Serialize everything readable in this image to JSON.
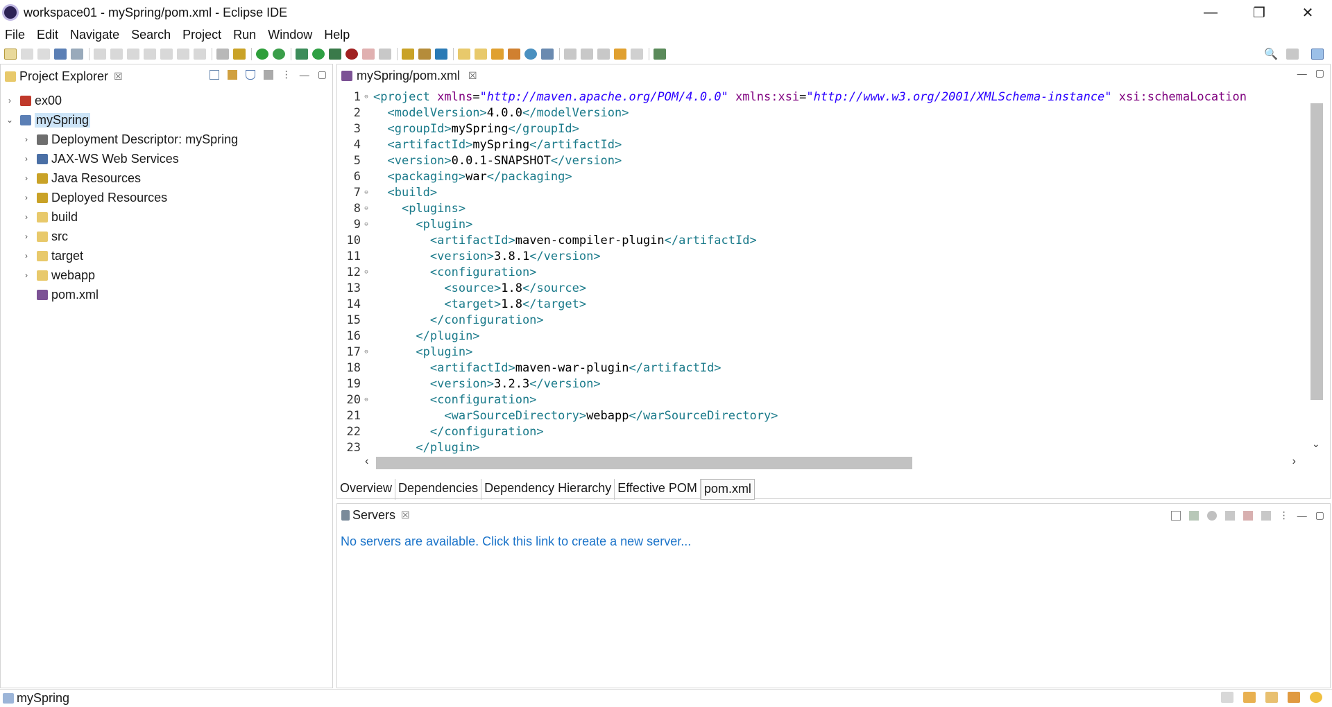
{
  "window": {
    "title": "workspace01 - mySpring/pom.xml - Eclipse IDE",
    "controls": [
      "—",
      "❐",
      "✕"
    ]
  },
  "menu": [
    "File",
    "Edit",
    "Navigate",
    "Search",
    "Project",
    "Run",
    "Window",
    "Help"
  ],
  "explorer": {
    "title": "Project Explorer",
    "close": "☒",
    "items": [
      {
        "label": "ex00",
        "twisty": "›",
        "icon_color": "#c0392b"
      },
      {
        "label": "mySpring",
        "twisty": "⌄",
        "icon_color": "#5b7fb5",
        "selected": true
      },
      {
        "label": "Deployment Descriptor: mySpring",
        "twisty": "›",
        "icon_color": "#6e6e6e"
      },
      {
        "label": "JAX-WS Web Services",
        "twisty": "›",
        "icon_color": "#4a6fa5"
      },
      {
        "label": "Java Resources",
        "twisty": "›",
        "icon_color": "#c9a227"
      },
      {
        "label": "Deployed Resources",
        "twisty": "›",
        "icon_color": "#c9a227"
      },
      {
        "label": "build",
        "twisty": "›",
        "icon_color": "#e8c96b"
      },
      {
        "label": "src",
        "twisty": "›",
        "icon_color": "#e8c96b"
      },
      {
        "label": "target",
        "twisty": "›",
        "icon_color": "#e8c96b"
      },
      {
        "label": "webapp",
        "twisty": "›",
        "icon_color": "#e8c96b"
      },
      {
        "label": "pom.xml",
        "twisty": "",
        "icon_color": "#7c5295"
      }
    ]
  },
  "editor": {
    "tab_label": "mySpring/pom.xml",
    "close": "☒",
    "lines": [
      {
        "n": "1",
        "fold": "⊖",
        "indent": "",
        "parts": [
          [
            "t",
            "<project "
          ],
          [
            "a",
            "xmlns"
          ],
          [
            "v",
            "="
          ],
          [
            "s",
            "\"http://maven.apache.org/POM/4.0.0\""
          ],
          [
            "v",
            " "
          ],
          [
            "a",
            "xmlns:xsi"
          ],
          [
            "v",
            "="
          ],
          [
            "s",
            "\"http://www.w3.org/2001/XMLSchema-instance\""
          ],
          [
            "v",
            " "
          ],
          [
            "a",
            "xsi:schemaLocation"
          ]
        ]
      },
      {
        "n": "2",
        "fold": "",
        "indent": "  ",
        "parts": [
          [
            "t",
            "<modelVersion>"
          ],
          [
            "v",
            "4.0.0"
          ],
          [
            "t",
            "</modelVersion>"
          ]
        ]
      },
      {
        "n": "3",
        "fold": "",
        "indent": "  ",
        "parts": [
          [
            "t",
            "<groupId>"
          ],
          [
            "v",
            "mySpring"
          ],
          [
            "t",
            "</groupId>"
          ]
        ]
      },
      {
        "n": "4",
        "fold": "",
        "indent": "  ",
        "parts": [
          [
            "t",
            "<artifactId>"
          ],
          [
            "v",
            "mySpring"
          ],
          [
            "t",
            "</artifactId>"
          ]
        ]
      },
      {
        "n": "5",
        "fold": "",
        "indent": "  ",
        "parts": [
          [
            "t",
            "<version>"
          ],
          [
            "v",
            "0.0.1-SNAPSHOT"
          ],
          [
            "t",
            "</version>"
          ]
        ]
      },
      {
        "n": "6",
        "fold": "",
        "indent": "  ",
        "parts": [
          [
            "t",
            "<packaging>"
          ],
          [
            "v",
            "war"
          ],
          [
            "t",
            "</packaging>"
          ]
        ]
      },
      {
        "n": "7",
        "fold": "⊖",
        "indent": "  ",
        "parts": [
          [
            "t",
            "<build>"
          ]
        ]
      },
      {
        "n": "8",
        "fold": "⊖",
        "indent": "    ",
        "parts": [
          [
            "t",
            "<plugins>"
          ]
        ]
      },
      {
        "n": "9",
        "fold": "⊖",
        "indent": "      ",
        "parts": [
          [
            "t",
            "<plugin>"
          ]
        ]
      },
      {
        "n": "10",
        "fold": "",
        "indent": "        ",
        "parts": [
          [
            "t",
            "<artifactId>"
          ],
          [
            "v",
            "maven-compiler-plugin"
          ],
          [
            "t",
            "</artifactId>"
          ]
        ]
      },
      {
        "n": "11",
        "fold": "",
        "indent": "        ",
        "parts": [
          [
            "t",
            "<version>"
          ],
          [
            "v",
            "3.8.1"
          ],
          [
            "t",
            "</version>"
          ]
        ]
      },
      {
        "n": "12",
        "fold": "⊖",
        "indent": "        ",
        "parts": [
          [
            "t",
            "<configuration>"
          ]
        ]
      },
      {
        "n": "13",
        "fold": "",
        "indent": "          ",
        "parts": [
          [
            "t",
            "<source>"
          ],
          [
            "v",
            "1.8"
          ],
          [
            "t",
            "</source>"
          ]
        ]
      },
      {
        "n": "14",
        "fold": "",
        "indent": "          ",
        "parts": [
          [
            "t",
            "<target>"
          ],
          [
            "v",
            "1.8"
          ],
          [
            "t",
            "</target>"
          ]
        ]
      },
      {
        "n": "15",
        "fold": "",
        "indent": "        ",
        "parts": [
          [
            "t",
            "</configuration>"
          ]
        ]
      },
      {
        "n": "16",
        "fold": "",
        "indent": "      ",
        "parts": [
          [
            "t",
            "</plugin>"
          ]
        ]
      },
      {
        "n": "17",
        "fold": "⊖",
        "indent": "      ",
        "parts": [
          [
            "t",
            "<plugin>"
          ]
        ]
      },
      {
        "n": "18",
        "fold": "",
        "indent": "        ",
        "parts": [
          [
            "t",
            "<artifactId>"
          ],
          [
            "v",
            "maven-war-plugin"
          ],
          [
            "t",
            "</artifactId>"
          ]
        ]
      },
      {
        "n": "19",
        "fold": "",
        "indent": "        ",
        "parts": [
          [
            "t",
            "<version>"
          ],
          [
            "v",
            "3.2.3"
          ],
          [
            "t",
            "</version>"
          ]
        ]
      },
      {
        "n": "20",
        "fold": "⊖",
        "indent": "        ",
        "parts": [
          [
            "t",
            "<configuration>"
          ]
        ]
      },
      {
        "n": "21",
        "fold": "",
        "indent": "          ",
        "parts": [
          [
            "t",
            "<warSourceDirectory>"
          ],
          [
            "v",
            "webapp"
          ],
          [
            "t",
            "</warSourceDirectory>"
          ]
        ]
      },
      {
        "n": "22",
        "fold": "",
        "indent": "        ",
        "parts": [
          [
            "t",
            "</configuration>"
          ]
        ]
      },
      {
        "n": "23",
        "fold": "",
        "indent": "      ",
        "parts": [
          [
            "t",
            "</plugin>"
          ]
        ]
      }
    ],
    "bottom_tabs": [
      "Overview",
      "Dependencies",
      "Dependency Hierarchy",
      "Effective POM",
      "pom.xml"
    ],
    "active_bottom_tab": "pom.xml"
  },
  "servers": {
    "title": "Servers",
    "close": "☒",
    "message": "No servers are available. Click this link to create a new server..."
  },
  "status": {
    "text": "mySpring"
  },
  "colors": {
    "tag": "#1a7a8a",
    "attribute": "#7f007f",
    "string": "#2a00ff",
    "link": "#1a73c9",
    "selection": "#cce4f7"
  }
}
